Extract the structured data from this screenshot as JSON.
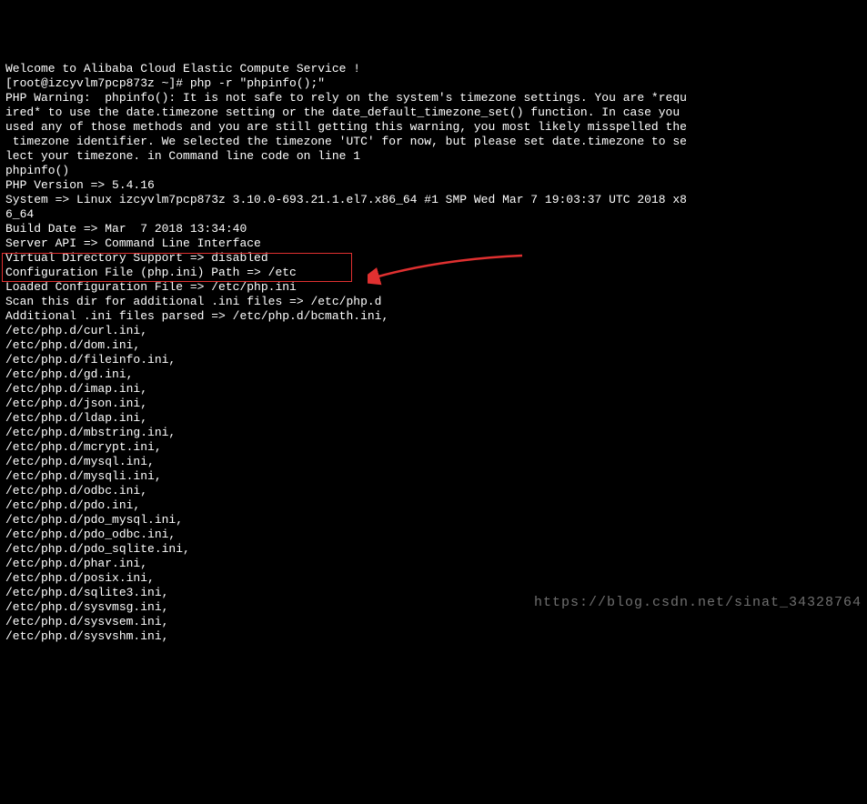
{
  "lines": [
    "Welcome to Alibaba Cloud Elastic Compute Service !",
    "",
    "[root@izcyvlm7pcp873z ~]# php -r \"phpinfo();\"",
    "PHP Warning:  phpinfo(): It is not safe to rely on the system's timezone settings. You are *requ",
    "ired* to use the date.timezone setting or the date_default_timezone_set() function. In case you",
    "used any of those methods and you are still getting this warning, you most likely misspelled the",
    " timezone identifier. We selected the timezone 'UTC' for now, but please set date.timezone to se",
    "lect your timezone. in Command line code on line 1",
    "phpinfo()",
    "PHP Version => 5.4.16",
    "",
    "System => Linux izcyvlm7pcp873z 3.10.0-693.21.1.el7.x86_64 #1 SMP Wed Mar 7 19:03:37 UTC 2018 x8",
    "6_64",
    "Build Date => Mar  7 2018 13:34:40",
    "Server API => Command Line Interface",
    "Virtual Directory Support => disabled",
    "Configuration File (php.ini) Path => /etc",
    "Loaded Configuration File => /etc/php.ini",
    "Scan this dir for additional .ini files => /etc/php.d",
    "Additional .ini files parsed => /etc/php.d/bcmath.ini,",
    "/etc/php.d/curl.ini,",
    "/etc/php.d/dom.ini,",
    "/etc/php.d/fileinfo.ini,",
    "/etc/php.d/gd.ini,",
    "/etc/php.d/imap.ini,",
    "/etc/php.d/json.ini,",
    "/etc/php.d/ldap.ini,",
    "/etc/php.d/mbstring.ini,",
    "/etc/php.d/mcrypt.ini,",
    "/etc/php.d/mysql.ini,",
    "/etc/php.d/mysqli.ini,",
    "/etc/php.d/odbc.ini,",
    "/etc/php.d/pdo.ini,",
    "/etc/php.d/pdo_mysql.ini,",
    "/etc/php.d/pdo_odbc.ini,",
    "/etc/php.d/pdo_sqlite.ini,",
    "/etc/php.d/phar.ini,",
    "/etc/php.d/posix.ini,",
    "/etc/php.d/sqlite3.ini,",
    "/etc/php.d/sysvmsg.ini,",
    "/etc/php.d/sysvsem.ini,",
    "/etc/php.d/sysvshm.ini,"
  ],
  "watermark": "https://blog.csdn.net/sinat_34328764",
  "annotation": {
    "highlight_color": "#e03030",
    "arrow_color": "#e03030"
  }
}
